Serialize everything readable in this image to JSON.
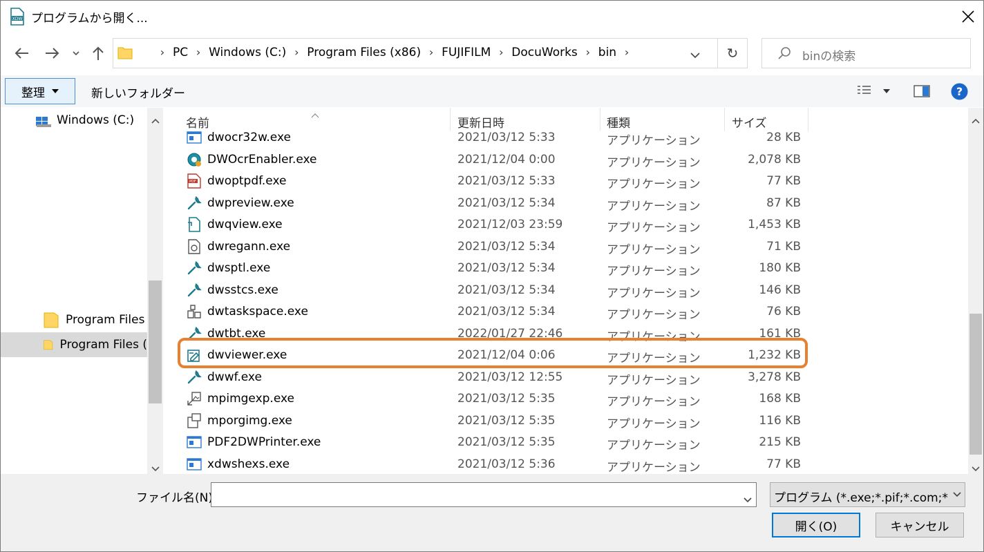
{
  "window": {
    "title": "プログラムから開く...",
    "app_icon": "xdw-icon",
    "close_icon": "close-icon"
  },
  "nav": {
    "back_icon": "back-arrow-icon",
    "forward_icon": "forward-arrow-icon",
    "recent_icon": "chevron-down-icon",
    "up_icon": "up-arrow-icon"
  },
  "address": {
    "crumbs": [
      "PC",
      "Windows (C:)",
      "Program Files (x86)",
      "FUJIFILM",
      "DocuWorks",
      "bin"
    ],
    "refresh_icon": "refresh-icon"
  },
  "search": {
    "placeholder": "binの検索",
    "icon": "search-icon"
  },
  "toolbar": {
    "organize_label": "整理",
    "new_folder_label": "新しいフォルダー",
    "view_icon": "view-options-icon",
    "preview_icon": "preview-pane-icon",
    "help_icon": "help-icon"
  },
  "nav_pane": {
    "items": [
      {
        "label": "Windows (C:)",
        "icon": "drive-icon"
      },
      {
        "label": "Program Files",
        "icon": "folder-icon"
      },
      {
        "label": "Program Files (",
        "icon": "folder-icon",
        "selected": true
      }
    ]
  },
  "columns": {
    "name": "名前",
    "date": "更新日時",
    "type": "種類",
    "size": "サイズ"
  },
  "files": [
    {
      "name": "dwocr32w.exe",
      "date": "2021/03/12 5:33",
      "type": "アプリケーション",
      "size": "28 KB",
      "icon": "app-window-icon"
    },
    {
      "name": "DWOcrEnabler.exe",
      "date": "2021/12/04 0:00",
      "type": "アプリケーション",
      "size": "2,078 KB",
      "icon": "ocr-gear-icon"
    },
    {
      "name": "dwoptpdf.exe",
      "date": "2021/03/12 5:33",
      "type": "アプリケーション",
      "size": "77 KB",
      "icon": "pdf-icon"
    },
    {
      "name": "dwpreview.exe",
      "date": "2021/03/12 5:34",
      "type": "アプリケーション",
      "size": "87 KB",
      "icon": "wrench-icon"
    },
    {
      "name": "dwqview.exe",
      "date": "2021/12/03 23:59",
      "type": "アプリケーション",
      "size": "1,453 KB",
      "icon": "document-icon"
    },
    {
      "name": "dwregann.exe",
      "date": "2021/03/12 5:34",
      "type": "アプリケーション",
      "size": "71 KB",
      "icon": "document-gear-icon"
    },
    {
      "name": "dwsptl.exe",
      "date": "2021/03/12 5:34",
      "type": "アプリケーション",
      "size": "180 KB",
      "icon": "wrench-icon"
    },
    {
      "name": "dwsstcs.exe",
      "date": "2021/03/12 5:34",
      "type": "アプリケーション",
      "size": "146 KB",
      "icon": "wrench-icon"
    },
    {
      "name": "dwtaskspace.exe",
      "date": "2021/03/12 5:34",
      "type": "アプリケーション",
      "size": "76 KB",
      "icon": "taskspace-icon"
    },
    {
      "name": "dwtbt.exe",
      "date": "2022/01/27 22:46",
      "type": "アプリケーション",
      "size": "161 KB",
      "icon": "wrench-icon"
    },
    {
      "name": "dwviewer.exe",
      "date": "2021/12/04 0:06",
      "type": "アプリケーション",
      "size": "1,232 KB",
      "icon": "viewer-icon",
      "highlighted": true
    },
    {
      "name": "dwwf.exe",
      "date": "2021/03/12 12:55",
      "type": "アプリケーション",
      "size": "3,278 KB",
      "icon": "wrench-icon"
    },
    {
      "name": "mpimgexp.exe",
      "date": "2021/03/12 5:35",
      "type": "アプリケーション",
      "size": "168 KB",
      "icon": "image-export-icon"
    },
    {
      "name": "mporgimg.exe",
      "date": "2021/03/12 5:35",
      "type": "アプリケーション",
      "size": "116 KB",
      "icon": "image-organize-icon"
    },
    {
      "name": "PDF2DWPrinter.exe",
      "date": "2021/03/12 5:35",
      "type": "アプリケーション",
      "size": "215 KB",
      "icon": "app-window-icon"
    },
    {
      "name": "xdwshexs.exe",
      "date": "2021/03/12 5:36",
      "type": "アプリケーション",
      "size": "77 KB",
      "icon": "app-window-icon"
    }
  ],
  "filename": {
    "label": "ファイル名(N):",
    "value": ""
  },
  "filetype": {
    "value": "プログラム (*.exe;*.pif;*.com;*.bat"
  },
  "buttons": {
    "open": "開く(O)",
    "cancel": "キャンセル"
  },
  "colors": {
    "highlight": "#e8812f",
    "accent": "#0078d7"
  }
}
